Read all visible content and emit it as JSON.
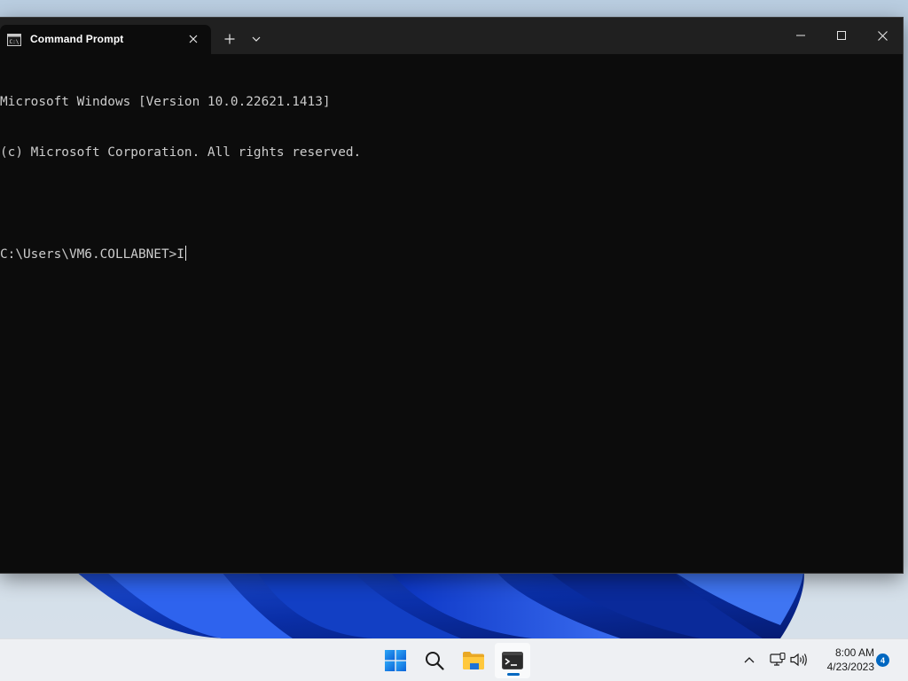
{
  "window": {
    "tab_title": "Command Prompt",
    "tab_icon": "cmd-icon",
    "controls": {
      "new_tab": "plus-icon",
      "dropdown": "chevron-down-icon",
      "minimize": "minimize-icon",
      "maximize": "maximize-icon",
      "close": "close-icon"
    }
  },
  "console": {
    "lines": [
      "Microsoft Windows [Version 10.0.22621.1413]",
      "(c) Microsoft Corporation. All rights reserved.",
      ""
    ],
    "prompt": "C:\\Users\\VM6.COLLABNET>",
    "input": "I"
  },
  "taskbar": {
    "apps": [
      {
        "name": "start",
        "icon": "windows-logo-icon"
      },
      {
        "name": "search",
        "icon": "search-icon"
      },
      {
        "name": "file-explorer",
        "icon": "folder-icon"
      },
      {
        "name": "terminal",
        "icon": "terminal-icon",
        "active": true
      }
    ],
    "tray": {
      "overflow_icon": "chevron-up-icon",
      "network_icon": "network-icon",
      "volume_icon": "volume-icon",
      "time": "8:00 AM",
      "date": "4/23/2023",
      "notification_count": "4"
    }
  },
  "colors": {
    "console_bg": "#0c0c0c",
    "console_text": "#cccccc",
    "titlebar_bg": "#202020",
    "accent": "#0067c0",
    "taskbar_bg": "#eef0f3"
  }
}
